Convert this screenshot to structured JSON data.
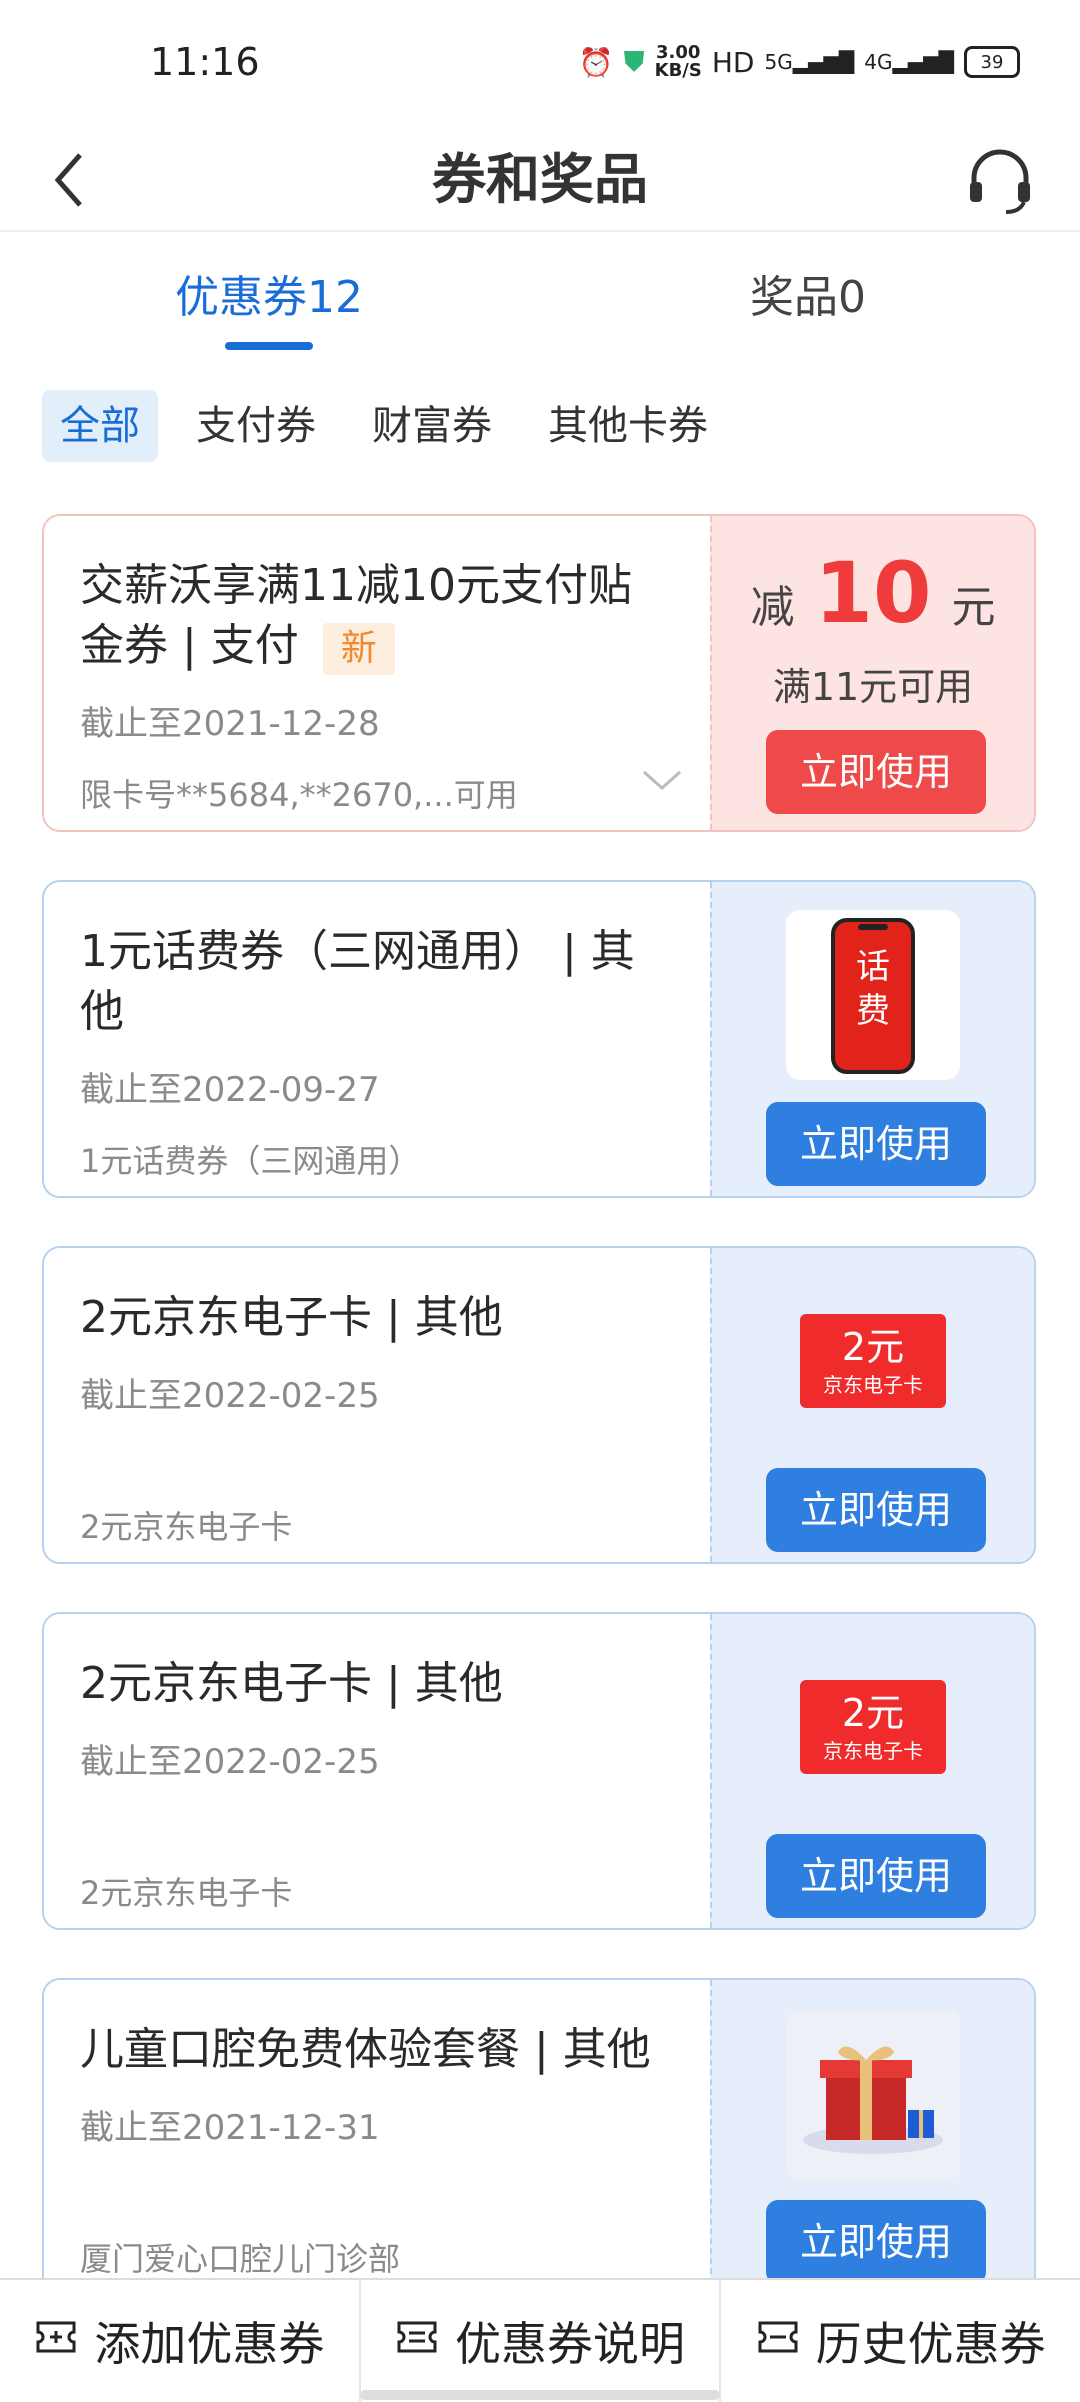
{
  "status_bar": {
    "time": "11:16",
    "net_speed_value": "3.00",
    "net_speed_unit": "KB/S",
    "hd": "HD",
    "sig5g": "5G",
    "sig4g": "4G",
    "battery": "39"
  },
  "header": {
    "title": "券和奖品"
  },
  "tabs": [
    {
      "label": "优惠券12",
      "active": true
    },
    {
      "label": "奖品0",
      "active": false
    }
  ],
  "filters": [
    {
      "label": "全部",
      "active": true
    },
    {
      "label": "支付券"
    },
    {
      "label": "财富券"
    },
    {
      "label": "其他卡券"
    }
  ],
  "coupons": [
    {
      "title_line1": "交薪沃享满11减10元支付贴",
      "title_line2": "金券 | 支付",
      "badge": "新",
      "expiry": "截止至2021-12-28",
      "desc": "限卡号**5684,**2670,...可用",
      "discount_prefix": "减",
      "discount_amount": "10",
      "discount_unit": "元",
      "min_spend": "满11元可用",
      "button": "立即使用"
    },
    {
      "title_line1": "1元话费券（三网通用） | 其",
      "title_line2": "他",
      "expiry": "截止至2022-09-27",
      "desc": "1元话费券（三网通用）",
      "image_text": [
        "话",
        "费"
      ],
      "button": "立即使用"
    },
    {
      "title_line1": "2元京东电子卡 | 其他",
      "expiry": "截止至2022-02-25",
      "desc": "2元京东电子卡",
      "card_value": "2元",
      "card_name": "京东电子卡",
      "button": "立即使用"
    },
    {
      "title_line1": "2元京东电子卡 | 其他",
      "expiry": "截止至2022-02-25",
      "desc": "2元京东电子卡",
      "card_value": "2元",
      "card_name": "京东电子卡",
      "button": "立即使用"
    },
    {
      "title_line1": "儿童口腔免费体验套餐 | 其他",
      "expiry": "截止至2021-12-31",
      "desc": "厦门爱心口腔儿门诊部",
      "button": "立即使用"
    }
  ],
  "bottom_bar": [
    {
      "label": "添加优惠券",
      "icon": "coupon-icon"
    },
    {
      "label": "优惠券说明",
      "icon": "coupon-icon"
    },
    {
      "label": "历史优惠券",
      "icon": "coupon-icon"
    }
  ],
  "colors": {
    "accent": "#1a6dd9",
    "red": "#ef4a4a",
    "blue_button": "#2f7fe0"
  }
}
